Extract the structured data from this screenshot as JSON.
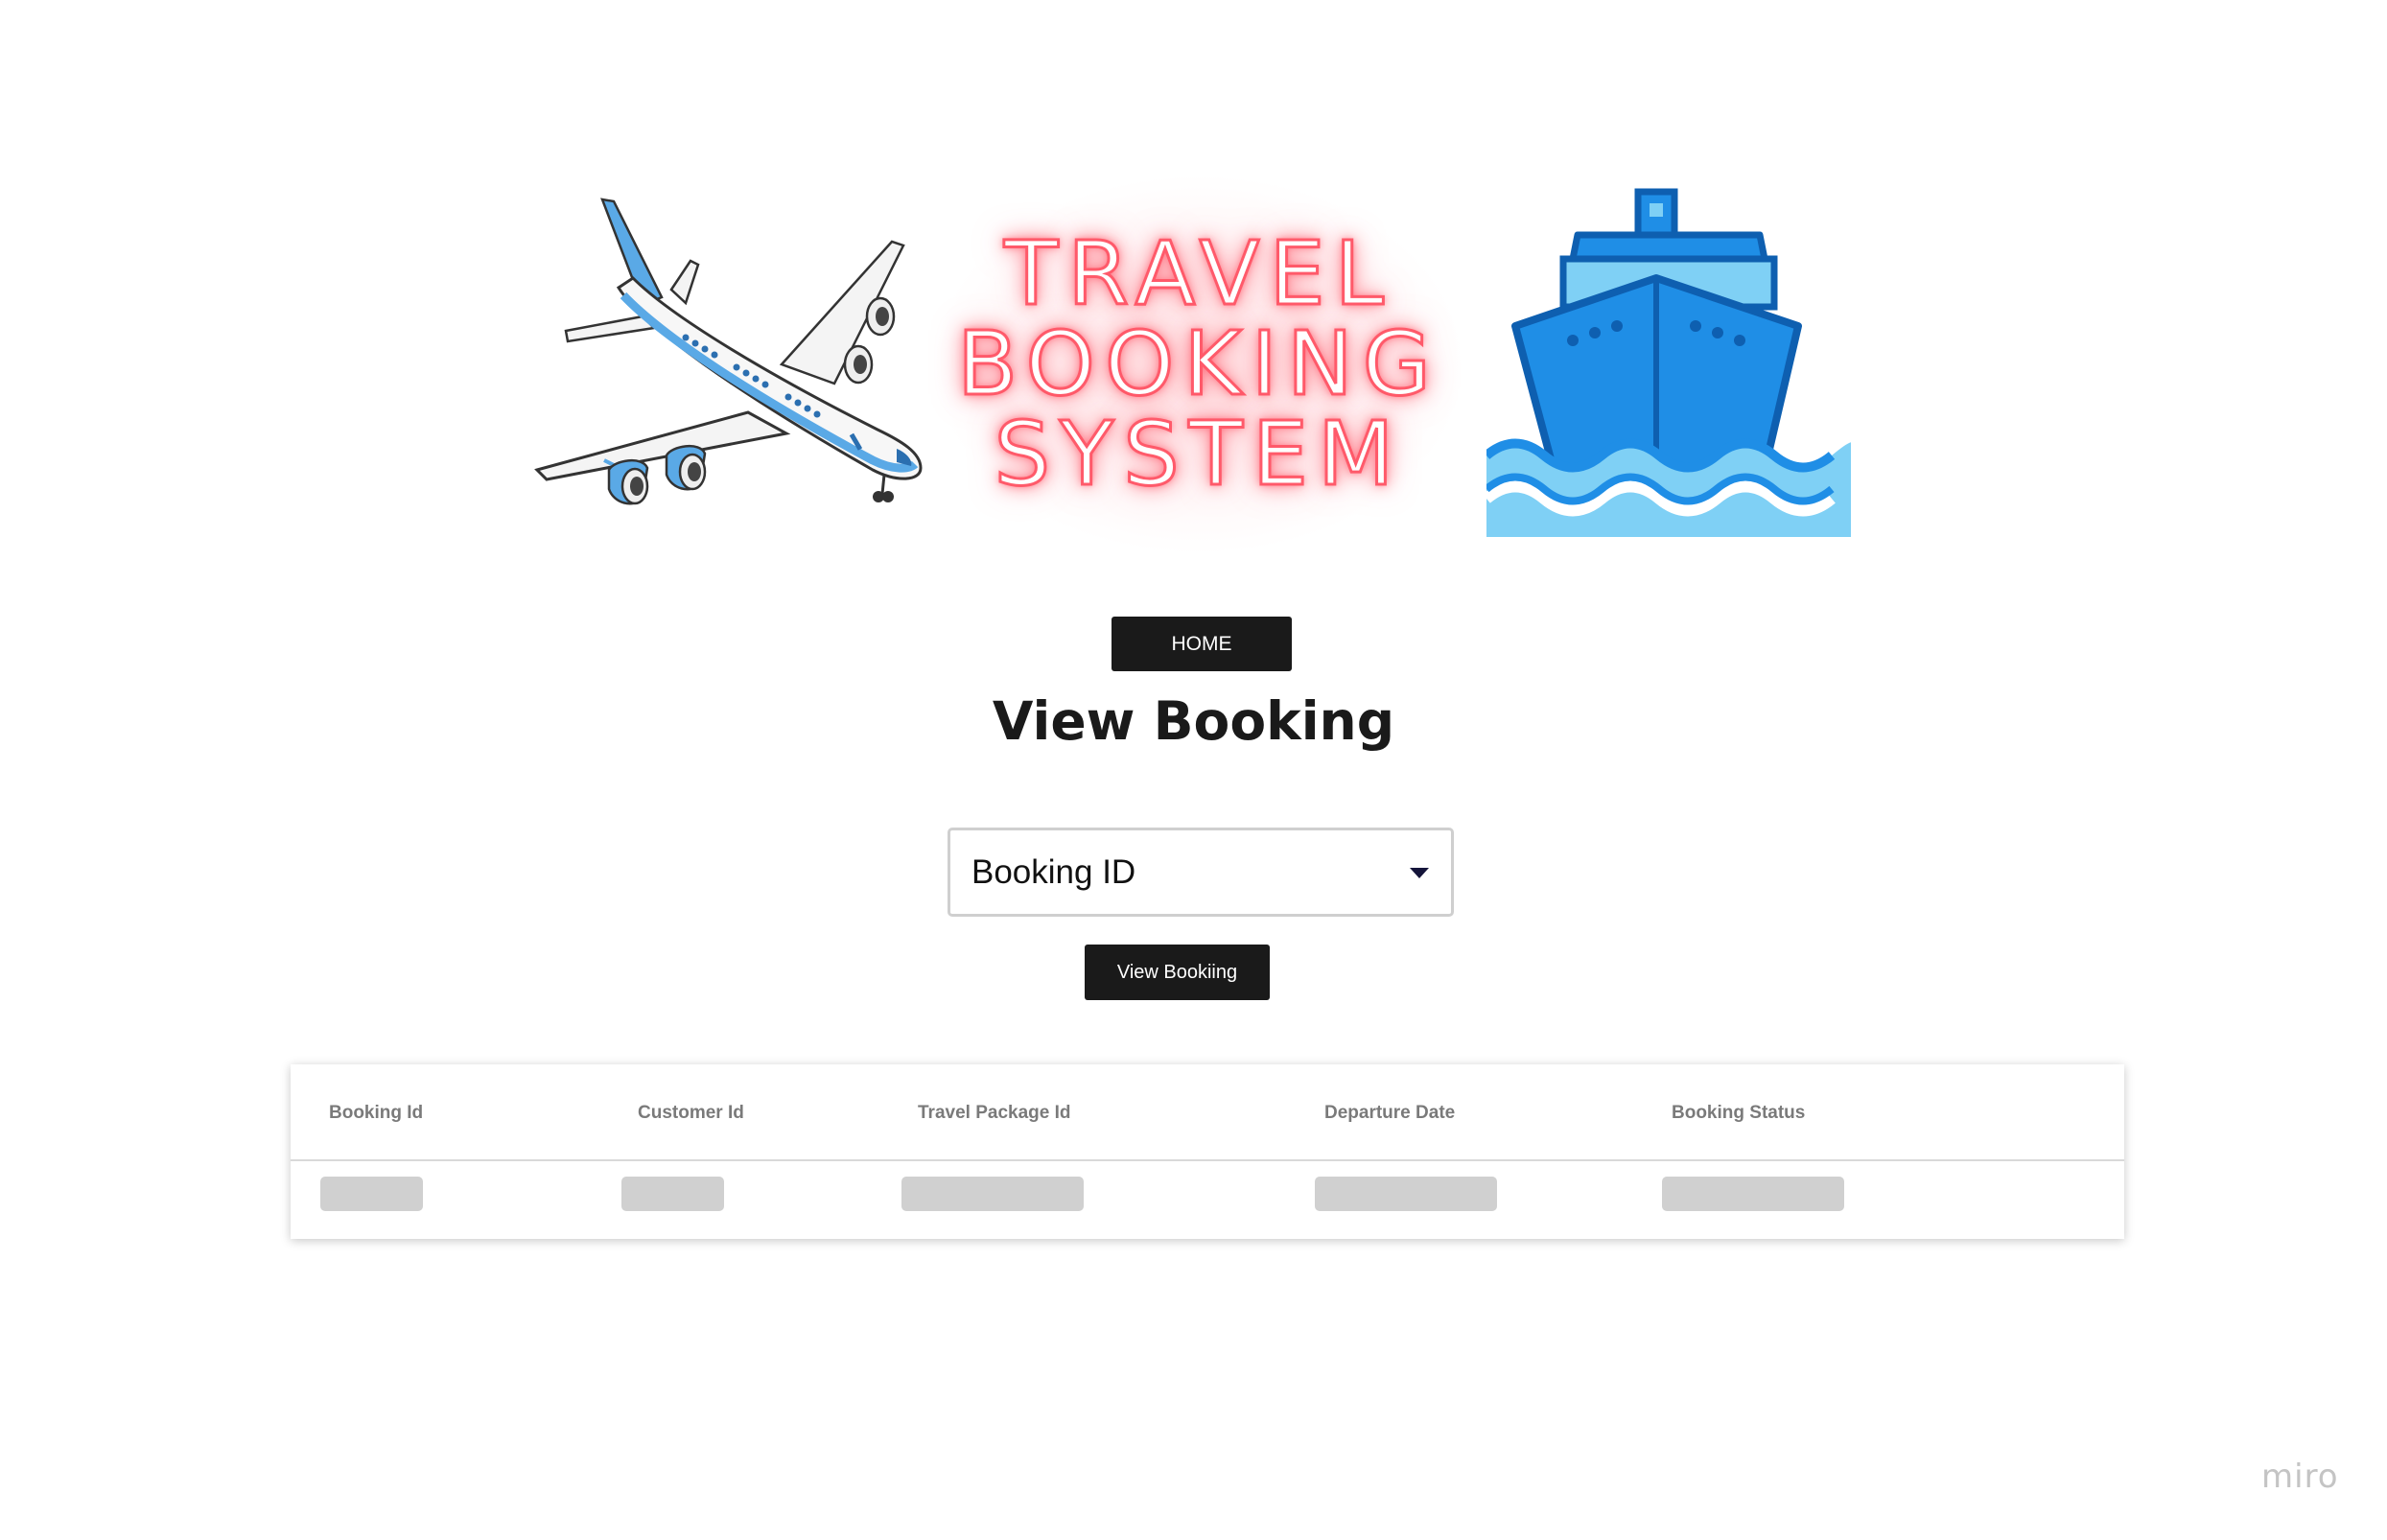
{
  "banner": {
    "title_lines": [
      "TRAVEL",
      "BOOKING",
      "SYSTEM"
    ],
    "plane_icon": "airplane-icon",
    "ship_icon": "ship-icon"
  },
  "nav": {
    "home_label": "HOME"
  },
  "page": {
    "title": "View Booking"
  },
  "filter": {
    "select_value": "Booking ID",
    "dropdown_icon": "caret-down-icon",
    "button_label": "View Bookiing"
  },
  "table": {
    "columns": [
      "Booking Id",
      "Customer Id",
      "Travel Package Id",
      "Departure Date",
      "Booking Status"
    ],
    "rows_loading": true
  },
  "watermark": {
    "text": "miro"
  },
  "colors": {
    "button_bg": "#1a1a1a",
    "neon_pink": "#ff5a6a",
    "plane_blue": "#5aa9e6",
    "ship_blue": "#1f8ee6",
    "water_light": "#7fd0f5",
    "skeleton": "#d0d0d0"
  }
}
